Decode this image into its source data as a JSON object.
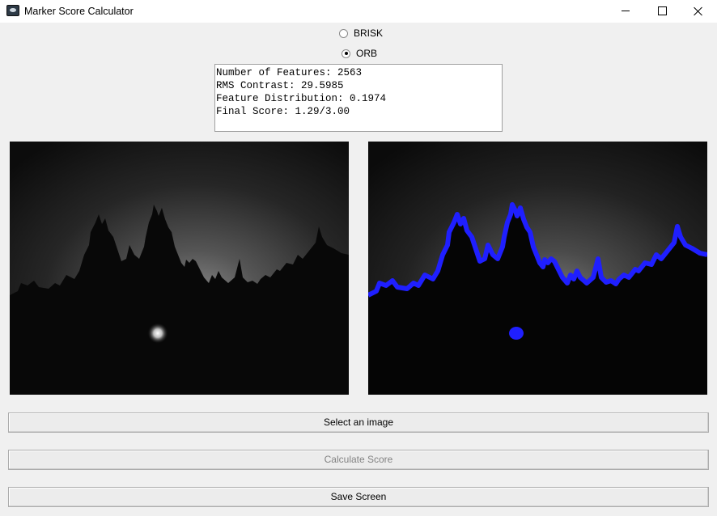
{
  "window": {
    "title": "Marker Score Calculator"
  },
  "detector": {
    "options": [
      {
        "label": "BRISK",
        "selected": false
      },
      {
        "label": "ORB",
        "selected": true
      }
    ]
  },
  "results": {
    "lines": [
      "Number of Features: 2563",
      "RMS Contrast: 29.5985",
      "Feature Distribution: 0.1974",
      "Final Score: 1.29/3.00"
    ]
  },
  "images": {
    "original_alt": "Grayscale night skyline silhouette",
    "features_alt": "Skyline with detected features",
    "feature_color": "#1f1fff"
  },
  "buttons": {
    "select_label": "Select an image",
    "calculate_label": "Calculate Score",
    "save_label": "Save Screen"
  }
}
